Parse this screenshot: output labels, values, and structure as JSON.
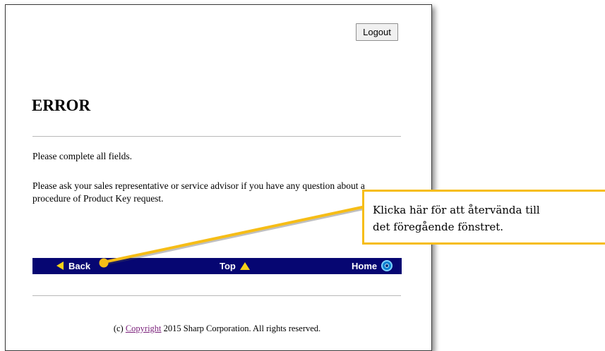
{
  "header": {
    "logout_label": "Logout"
  },
  "main": {
    "title": "ERROR",
    "message": "Please complete all fields.",
    "help_text": "Please ask your sales representative or service advisor if you have any question about a procedure of Product Key request."
  },
  "nav": {
    "back_label": "Back",
    "top_label": "Top",
    "home_label": "Home"
  },
  "footer": {
    "prefix": "(c) ",
    "link_label": "Copyright",
    "suffix": " 2015 Sharp Corporation. All rights reserved."
  },
  "callout": {
    "line1": "Klicka här för att återvända till",
    "line2": "det föregående fönstret."
  },
  "colors": {
    "nav_background": "#060672",
    "accent_yellow": "#f6d218",
    "callout_border": "#f6bd16"
  },
  "icons": {
    "back": "left-triangle-icon",
    "top": "up-triangle-icon",
    "home": "home-circle-icon"
  }
}
